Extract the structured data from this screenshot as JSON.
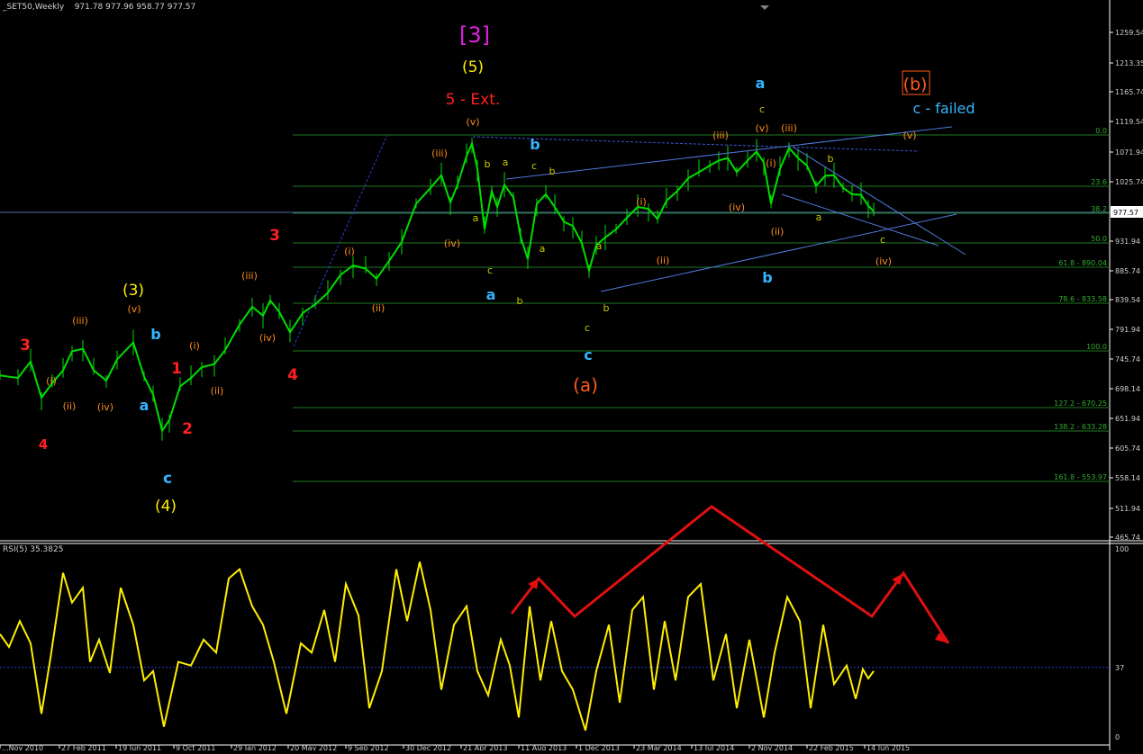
{
  "header": {
    "symbol": "_SET50,Weekly",
    "ohlc": "971.78 977.96 958.77 977.57"
  },
  "rsi": {
    "title": "RSI(5) 35.3825",
    "level_label": "37",
    "scale": [
      "100",
      "0"
    ]
  },
  "price_axis": {
    "ticks": [
      "1259.54",
      "1213.35",
      "1165.74",
      "1119.54",
      "1071.94",
      "1025.74",
      "979.54",
      "931.94",
      "885.74",
      "839.54",
      "791.94",
      "745.74",
      "698.14",
      "651.94",
      "605.74",
      "558.14",
      "511.94",
      "465.74"
    ],
    "current_price": "977.57"
  },
  "fib_levels": [
    {
      "label": "0.0"
    },
    {
      "label": "23.6"
    },
    {
      "label": "38.2"
    },
    {
      "label": "50.0"
    },
    {
      "label": "61.8 - 890.04"
    },
    {
      "label": "78.6 - 833.58"
    },
    {
      "label": "100.0"
    },
    {
      "label": "127.2 - 670.25"
    },
    {
      "label": "138.2 - 633.28"
    },
    {
      "label": "161.8 - 553.97"
    }
  ],
  "x_axis": {
    "labels": [
      "...Nov 2010",
      "27 Feb 2011",
      "19 Jun 2011",
      "9 Oct 2011",
      "29 Jan 2012",
      "20 May 2012",
      "9 Sep 2012",
      "30 Dec 2012",
      "21 Apr 2013",
      "11 Aug 2013",
      "1 Dec 2013",
      "23 Mar 2014",
      "13 Jul 2014",
      "2 Nov 2014",
      "22 Feb 2015",
      "14 Jun 2015"
    ]
  },
  "wave_labels": [
    {
      "text": "3",
      "color": "#ff2020"
    },
    {
      "text": "4",
      "color": "#ff2020"
    },
    {
      "text": "(i)",
      "color": "#ff8c1a"
    },
    {
      "text": "(ii)",
      "color": "#ff8c1a"
    },
    {
      "text": "(iii)",
      "color": "#ff8c1a"
    },
    {
      "text": "(iv)",
      "color": "#ff8c1a"
    },
    {
      "text": "(v)",
      "color": "#ff8c1a"
    },
    {
      "text": "(3)",
      "color": "#ffee00"
    },
    {
      "text": "a",
      "color": "#33b5ff"
    },
    {
      "text": "b",
      "color": "#33b5ff"
    },
    {
      "text": "c",
      "color": "#33b5ff"
    },
    {
      "text": "(4)",
      "color": "#ffee00"
    },
    {
      "text": "1",
      "color": "#ff2020"
    },
    {
      "text": "2",
      "color": "#ff2020"
    },
    {
      "text": "(i)",
      "color": "#ff8c1a"
    },
    {
      "text": "(ii)",
      "color": "#ff8c1a"
    },
    {
      "text": "(iii)",
      "color": "#ff8c1a"
    },
    {
      "text": "(iv)",
      "color": "#ff8c1a"
    },
    {
      "text": "3",
      "color": "#ff2020"
    },
    {
      "text": "4",
      "color": "#ff2020"
    },
    {
      "text": "(i)",
      "color": "#ff8c1a"
    },
    {
      "text": "(ii)",
      "color": "#ff8c1a"
    },
    {
      "text": "(iii)",
      "color": "#ff8c1a"
    },
    {
      "text": "(iv)",
      "color": "#ff8c1a"
    },
    {
      "text": "(v)",
      "color": "#ff8c1a"
    },
    {
      "text": "[3]",
      "color": "#e020e0"
    },
    {
      "text": "(5)",
      "color": "#ffee00"
    },
    {
      "text": "5 - Ext.",
      "color": "#ff2020"
    },
    {
      "text": "b",
      "color": "#c8c800"
    },
    {
      "text": "a",
      "color": "#c8c800"
    },
    {
      "text": "a",
      "color": "#c8c800"
    },
    {
      "text": "c",
      "color": "#c8c800"
    },
    {
      "text": "a",
      "color": "#33b5ff"
    },
    {
      "text": "b",
      "color": "#33b5ff"
    },
    {
      "text": "c",
      "color": "#c8c800"
    },
    {
      "text": "b",
      "color": "#c8c800"
    },
    {
      "text": "a",
      "color": "#c8c800"
    },
    {
      "text": "b",
      "color": "#c8c800"
    },
    {
      "text": "a",
      "color": "#c8c800"
    },
    {
      "text": "b",
      "color": "#c8c800"
    },
    {
      "text": "c",
      "color": "#c8c800"
    },
    {
      "text": "c",
      "color": "#33b5ff"
    },
    {
      "text": "(a)",
      "color": "#ff5a1a"
    },
    {
      "text": "(i)",
      "color": "#ff8c1a"
    },
    {
      "text": "(ii)",
      "color": "#ff8c1a"
    },
    {
      "text": "(iii)",
      "color": "#ff8c1a"
    },
    {
      "text": "(iv)",
      "color": "#ff8c1a"
    },
    {
      "text": "(v)",
      "color": "#ff8c1a"
    },
    {
      "text": "c",
      "color": "#c8c800"
    },
    {
      "text": "a",
      "color": "#33b5ff"
    },
    {
      "text": "(i)",
      "color": "#ff8c1a"
    },
    {
      "text": "(ii)",
      "color": "#ff8c1a"
    },
    {
      "text": "(iii)",
      "color": "#ff8c1a"
    },
    {
      "text": "b",
      "color": "#33b5ff"
    },
    {
      "text": "b",
      "color": "#c8c800"
    },
    {
      "text": "a",
      "color": "#c8c800"
    },
    {
      "text": "c",
      "color": "#c8c800"
    },
    {
      "text": "(iv)",
      "color": "#ff8c1a"
    },
    {
      "text": "(v)",
      "color": "#ff8c1a"
    },
    {
      "text": "c - failed",
      "color": "#33b5ff"
    },
    {
      "text": "(b)",
      "color": "#ff5a1a"
    }
  ],
  "chart_data": {
    "type": "line",
    "title": "_SET50,Weekly",
    "ylim": [
      465.74,
      1285
    ],
    "price_series": [
      [
        0,
        720
      ],
      [
        20,
        716
      ],
      [
        34,
        742
      ],
      [
        46,
        685
      ],
      [
        58,
        708
      ],
      [
        70,
        728
      ],
      [
        80,
        758
      ],
      [
        92,
        762
      ],
      [
        104,
        728
      ],
      [
        118,
        712
      ],
      [
        130,
        745
      ],
      [
        148,
        772
      ],
      [
        160,
        718
      ],
      [
        170,
        690
      ],
      [
        180,
        633
      ],
      [
        188,
        650
      ],
      [
        200,
        703
      ],
      [
        212,
        716
      ],
      [
        224,
        733
      ],
      [
        238,
        738
      ],
      [
        250,
        760
      ],
      [
        266,
        800
      ],
      [
        280,
        828
      ],
      [
        292,
        814
      ],
      [
        300,
        838
      ],
      [
        310,
        820
      ],
      [
        322,
        788
      ],
      [
        336,
        818
      ],
      [
        350,
        832
      ],
      [
        364,
        850
      ],
      [
        378,
        878
      ],
      [
        392,
        893
      ],
      [
        406,
        888
      ],
      [
        418,
        872
      ],
      [
        432,
        900
      ],
      [
        446,
        930
      ],
      [
        462,
        990
      ],
      [
        478,
        1015
      ],
      [
        490,
        1035
      ],
      [
        500,
        992
      ],
      [
        508,
        1020
      ],
      [
        518,
        1065
      ],
      [
        524,
        1085
      ],
      [
        530,
        1045
      ],
      [
        538,
        950
      ],
      [
        546,
        1010
      ],
      [
        552,
        985
      ],
      [
        560,
        1020
      ],
      [
        570,
        1000
      ],
      [
        578,
        938
      ],
      [
        586,
        903
      ],
      [
        596,
        990
      ],
      [
        606,
        1005
      ],
      [
        616,
        985
      ],
      [
        626,
        962
      ],
      [
        636,
        955
      ],
      [
        646,
        928
      ],
      [
        654,
        885
      ],
      [
        662,
        925
      ],
      [
        672,
        937
      ],
      [
        684,
        950
      ],
      [
        696,
        968
      ],
      [
        708,
        985
      ],
      [
        720,
        982
      ],
      [
        730,
        966
      ],
      [
        740,
        995
      ],
      [
        752,
        1010
      ],
      [
        764,
        1030
      ],
      [
        776,
        1040
      ],
      [
        788,
        1050
      ],
      [
        798,
        1058
      ],
      [
        808,
        1062
      ],
      [
        818,
        1040
      ],
      [
        830,
        1058
      ],
      [
        840,
        1072
      ],
      [
        848,
        1055
      ],
      [
        856,
        990
      ],
      [
        866,
        1045
      ],
      [
        876,
        1078
      ],
      [
        886,
        1062
      ],
      [
        896,
        1050
      ],
      [
        906,
        1018
      ],
      [
        916,
        1034
      ],
      [
        926,
        1035
      ],
      [
        936,
        1015
      ],
      [
        946,
        1005
      ],
      [
        956,
        1004
      ],
      [
        964,
        987
      ],
      [
        970,
        978
      ]
    ],
    "rsi_series": [
      [
        0,
        55
      ],
      [
        10,
        48
      ],
      [
        22,
        62
      ],
      [
        34,
        50
      ],
      [
        46,
        12
      ],
      [
        56,
        42
      ],
      [
        70,
        88
      ],
      [
        80,
        72
      ],
      [
        92,
        80
      ],
      [
        100,
        40
      ],
      [
        110,
        52
      ],
      [
        122,
        34
      ],
      [
        134,
        80
      ],
      [
        148,
        60
      ],
      [
        160,
        30
      ],
      [
        170,
        35
      ],
      [
        182,
        5
      ],
      [
        198,
        40
      ],
      [
        212,
        38
      ],
      [
        226,
        52
      ],
      [
        240,
        45
      ],
      [
        254,
        85
      ],
      [
        266,
        90
      ],
      [
        280,
        70
      ],
      [
        292,
        60
      ],
      [
        304,
        40
      ],
      [
        318,
        12
      ],
      [
        334,
        50
      ],
      [
        346,
        45
      ],
      [
        360,
        68
      ],
      [
        372,
        40
      ],
      [
        384,
        82
      ],
      [
        398,
        65
      ],
      [
        410,
        15
      ],
      [
        424,
        35
      ],
      [
        440,
        90
      ],
      [
        452,
        62
      ],
      [
        466,
        94
      ],
      [
        478,
        68
      ],
      [
        490,
        25
      ],
      [
        504,
        60
      ],
      [
        518,
        70
      ],
      [
        530,
        35
      ],
      [
        542,
        22
      ],
      [
        556,
        52
      ],
      [
        566,
        38
      ],
      [
        576,
        10
      ],
      [
        588,
        70
      ],
      [
        600,
        30
      ],
      [
        612,
        62
      ],
      [
        624,
        35
      ],
      [
        636,
        25
      ],
      [
        650,
        3
      ],
      [
        662,
        35
      ],
      [
        676,
        60
      ],
      [
        688,
        18
      ],
      [
        702,
        68
      ],
      [
        714,
        75
      ],
      [
        726,
        25
      ],
      [
        738,
        62
      ],
      [
        750,
        30
      ],
      [
        764,
        75
      ],
      [
        778,
        82
      ],
      [
        792,
        30
      ],
      [
        806,
        55
      ],
      [
        818,
        15
      ],
      [
        832,
        52
      ],
      [
        848,
        10
      ],
      [
        860,
        45
      ],
      [
        874,
        75
      ],
      [
        888,
        62
      ],
      [
        900,
        15
      ],
      [
        914,
        60
      ],
      [
        926,
        28
      ],
      [
        940,
        38
      ],
      [
        950,
        20
      ],
      [
        958,
        36
      ],
      [
        964,
        31
      ],
      [
        970,
        35
      ]
    ],
    "rsi_level": 37
  }
}
